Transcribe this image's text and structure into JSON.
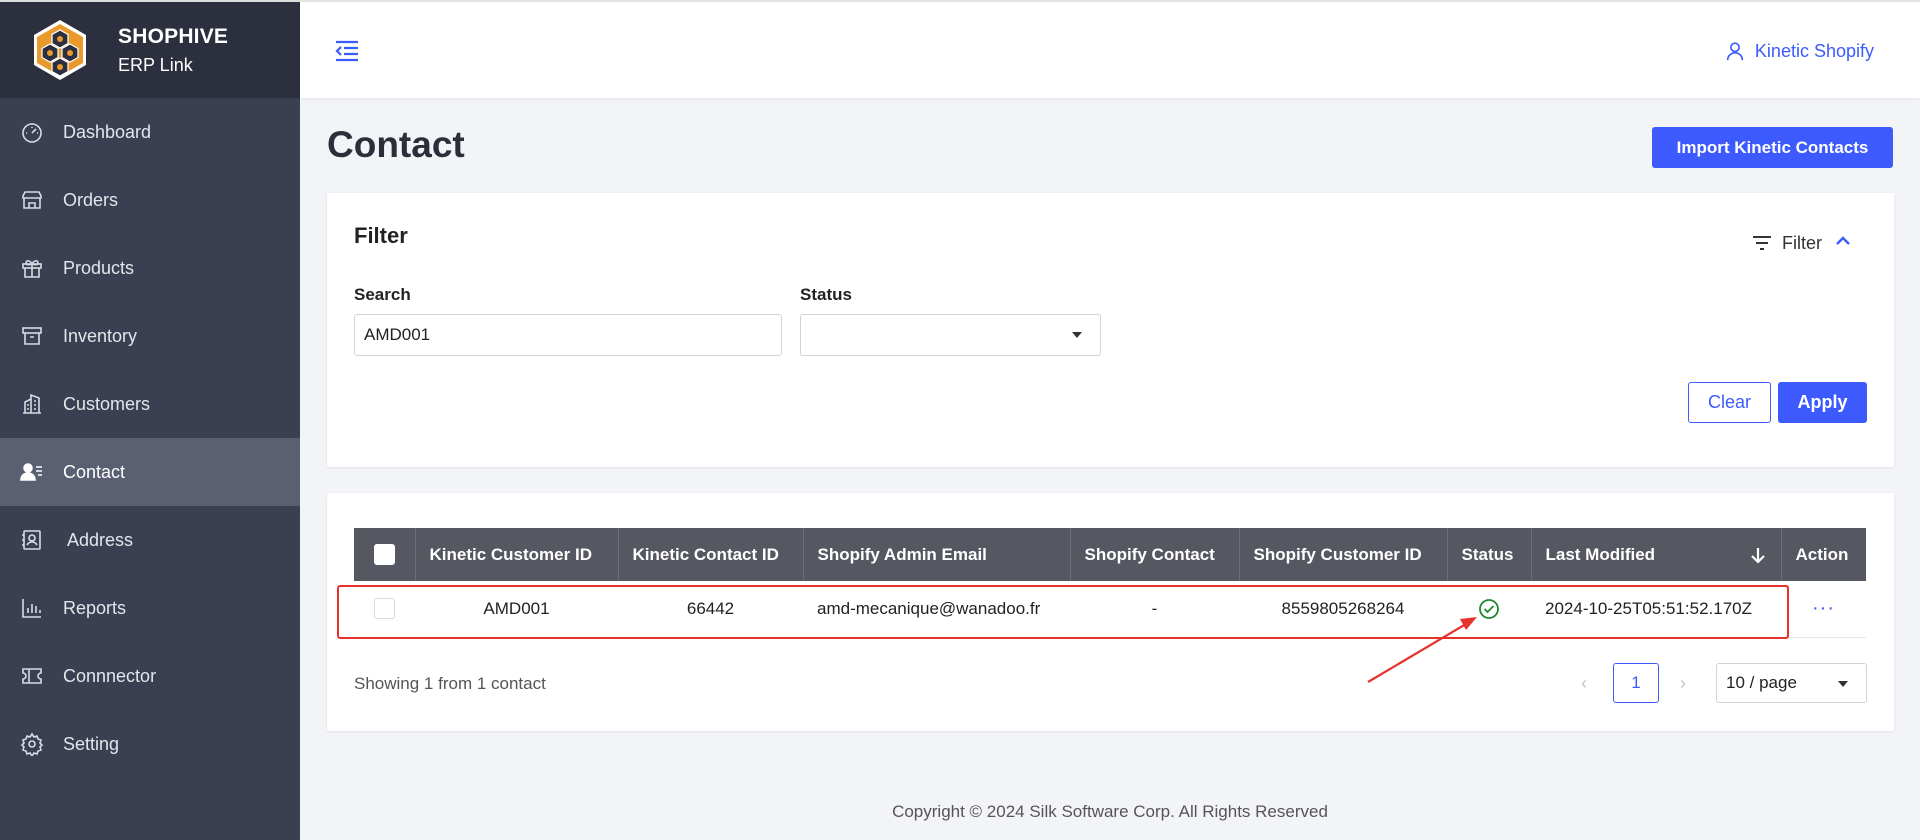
{
  "brand": {
    "name": "SHOPHIVE",
    "subtitle": "ERP Link"
  },
  "sidebar": {
    "items": [
      {
        "label": "Dashboard",
        "icon": "dashboard-icon"
      },
      {
        "label": "Orders",
        "icon": "store-icon"
      },
      {
        "label": "Products",
        "icon": "gift-icon"
      },
      {
        "label": "Inventory",
        "icon": "archive-icon"
      },
      {
        "label": "Customers",
        "icon": "building-icon"
      },
      {
        "label": "Contact",
        "icon": "contact-icon",
        "active": true
      },
      {
        "label": "Address",
        "icon": "address-icon"
      },
      {
        "label": "Reports",
        "icon": "bar-chart-icon"
      },
      {
        "label": "Connnector",
        "icon": "ticket-icon"
      },
      {
        "label": "Setting",
        "icon": "gear-icon"
      }
    ]
  },
  "header": {
    "user_name": "Kinetic Shopify"
  },
  "page": {
    "title": "Contact",
    "import_button": "Import Kinetic Contacts"
  },
  "filter": {
    "title": "Filter",
    "toggle_label": "Filter",
    "search_label": "Search",
    "search_value": "AMD001",
    "status_label": "Status",
    "status_value": "",
    "clear_label": "Clear",
    "apply_label": "Apply"
  },
  "table": {
    "columns": [
      "Kinetic Customer ID",
      "Kinetic Contact ID",
      "Shopify Admin Email",
      "Shopify Contact",
      "Shopify Customer ID",
      "Status",
      "Last Modified",
      "Action"
    ],
    "rows": [
      {
        "kinetic_customer_id": "AMD001",
        "kinetic_contact_id": "66442",
        "shopify_admin_email": "amd-mecanique@wanadoo.fr",
        "shopify_contact": "-",
        "shopify_customer_id": "8559805268264",
        "status": "check-circle-icon",
        "last_modified": "2024-10-25T05:51:52.170Z",
        "action": "···"
      }
    ],
    "summary": "Showing 1 from 1 contact",
    "current_page": "1",
    "page_size": "10 / page"
  },
  "footer": {
    "copyright": "Copyright © 2024 Silk Software Corp. All Rights Reserved"
  },
  "colors": {
    "accent": "#3d5afe",
    "sidebar": "#3a3f51",
    "highlight": "#e8312a",
    "success": "#1c8a2c"
  }
}
